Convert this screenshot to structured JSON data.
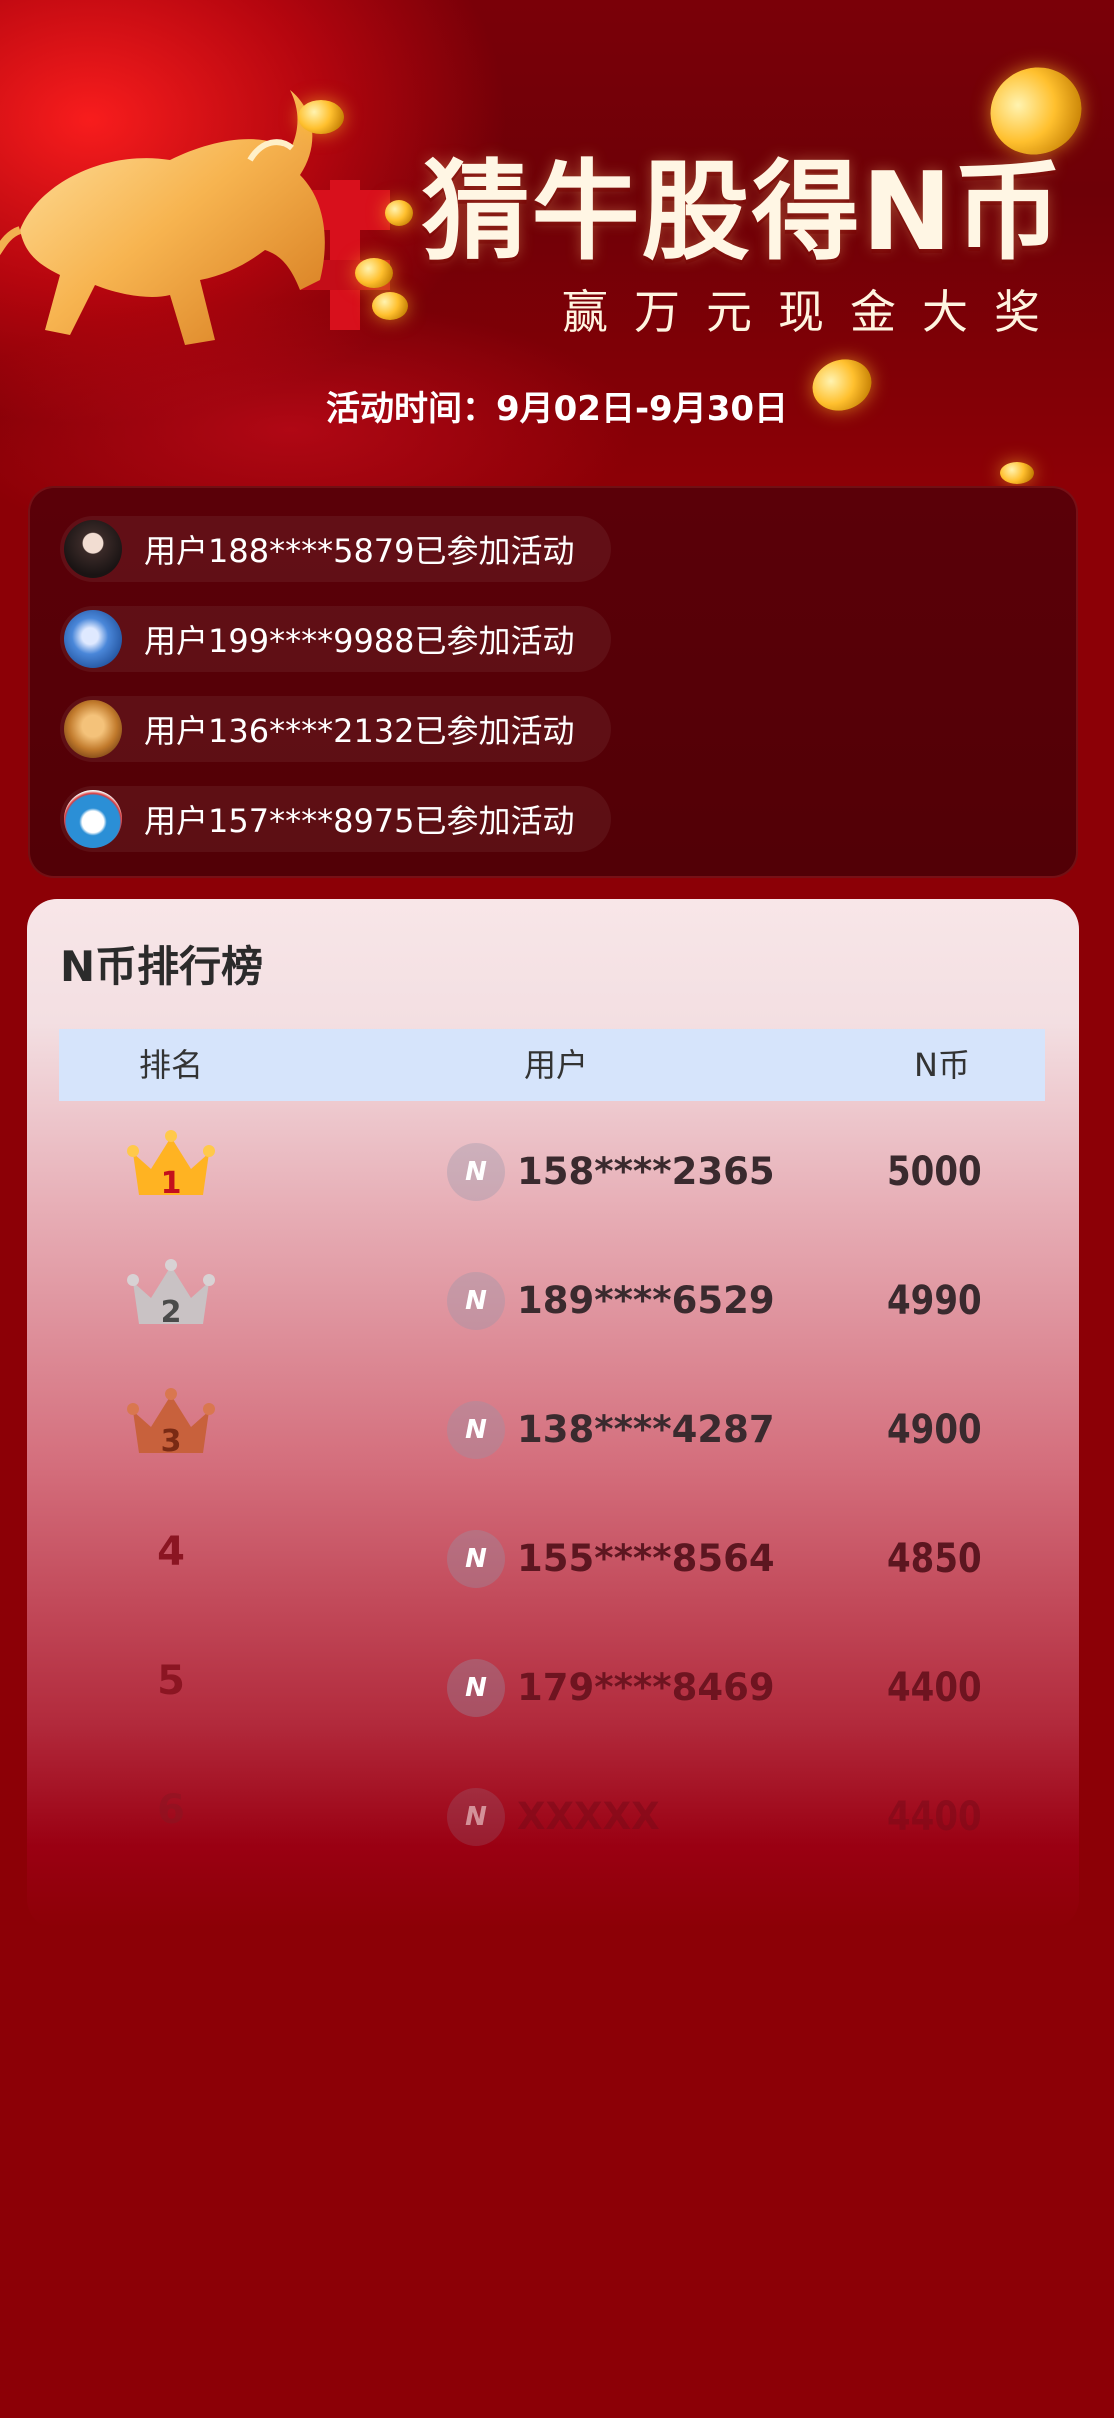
{
  "hero": {
    "title": "猜牛股得N币",
    "subtitle": "赢万元现金大奖",
    "event_time": "活动时间：9月02日-9月30日"
  },
  "participants": [
    {
      "text": "用户188****5879已参加活动",
      "avatar": "photo-girl"
    },
    {
      "text": "用户199****9988已参加活动",
      "avatar": "photo-blue"
    },
    {
      "text": "用户136****2132已参加活动",
      "avatar": "photo-dog"
    },
    {
      "text": "用户157****8975已参加活动",
      "avatar": "doraemon"
    }
  ],
  "leaderboard": {
    "title": "N币排行榜",
    "columns": {
      "rank": "排名",
      "user": "用户",
      "coins": "N币"
    },
    "rows": [
      {
        "rank": "1",
        "user": "158****2365",
        "coins": "5000",
        "badge": "gold-crown"
      },
      {
        "rank": "2",
        "user": "189****6529",
        "coins": "4990",
        "badge": "silver-crown"
      },
      {
        "rank": "3",
        "user": "138****4287",
        "coins": "4900",
        "badge": "bronze-crown"
      },
      {
        "rank": "4",
        "user": "155****8564",
        "coins": "4850",
        "badge": ""
      },
      {
        "rank": "5",
        "user": "179****8469",
        "coins": "4400",
        "badge": ""
      },
      {
        "rank": "6",
        "user": "XXXXX",
        "coins": "4400",
        "badge": ""
      }
    ],
    "avatar_icon": "N"
  },
  "colors": {
    "background": "#8c0006",
    "gold": "#ffb322",
    "silver": "#c9c2c4",
    "bronze": "#c8613c",
    "header_row": "#d6e4fb"
  }
}
